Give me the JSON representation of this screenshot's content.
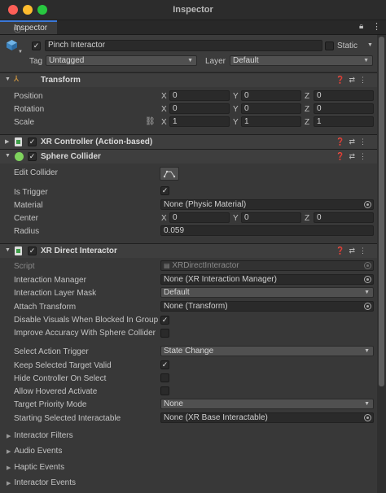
{
  "window": {
    "title": "Inspector"
  },
  "tab": {
    "label": "Inspector",
    "lock_icon": "lock-icon",
    "menu_icon": "kebab-icon"
  },
  "gameobject": {
    "name": "Pinch Interactor",
    "active": true,
    "static_label": "Static",
    "tag_label": "Tag",
    "tag_value": "Untagged",
    "layer_label": "Layer",
    "layer_value": "Default"
  },
  "transform": {
    "title": "Transform",
    "rows": [
      {
        "label": "Position",
        "x": "0",
        "y": "0",
        "z": "0"
      },
      {
        "label": "Rotation",
        "x": "0",
        "y": "0",
        "z": "0"
      },
      {
        "label": "Scale",
        "x": "1",
        "y": "1",
        "z": "1"
      }
    ]
  },
  "axis": {
    "x": "X",
    "y": "Y",
    "z": "Z"
  },
  "xr_controller": {
    "title": "XR Controller (Action-based)",
    "enabled": true
  },
  "sphere_collider": {
    "title": "Sphere Collider",
    "enabled": true,
    "edit_collider_label": "Edit Collider",
    "is_trigger_label": "Is Trigger",
    "is_trigger": true,
    "material_label": "Material",
    "material_value": "None (Physic Material)",
    "center_label": "Center",
    "center": {
      "x": "0",
      "y": "0",
      "z": "0"
    },
    "radius_label": "Radius",
    "radius_value": "0.059"
  },
  "xr_direct": {
    "title": "XR Direct Interactor",
    "enabled": true,
    "script_label": "Script",
    "script_value": "XRDirectInteractor",
    "interaction_manager_label": "Interaction Manager",
    "interaction_manager_value": "None (XR Interaction Manager)",
    "layer_mask_label": "Interaction Layer Mask",
    "layer_mask_value": "Default",
    "attach_transform_label": "Attach Transform",
    "attach_transform_value": "None (Transform)",
    "disable_visuals_label": "Disable Visuals When Blocked In Group",
    "disable_visuals": true,
    "improve_accuracy_label": "Improve Accuracy With Sphere Collider",
    "improve_accuracy": false,
    "select_trigger_label": "Select Action Trigger",
    "select_trigger_value": "State Change",
    "keep_selected_label": "Keep Selected Target Valid",
    "keep_selected": true,
    "hide_controller_label": "Hide Controller On Select",
    "hide_controller": false,
    "allow_hovered_label": "Allow Hovered Activate",
    "allow_hovered": false,
    "priority_mode_label": "Target Priority Mode",
    "priority_mode_value": "None",
    "starting_selected_label": "Starting Selected Interactable",
    "starting_selected_value": "None (XR Base Interactable)"
  },
  "sections": [
    {
      "label": "Interactor Filters"
    },
    {
      "label": "Audio Events"
    },
    {
      "label": "Haptic Events"
    },
    {
      "label": "Interactor Events"
    }
  ],
  "colors": {
    "accent": "#3b78d8",
    "close": "#fe5f57",
    "minimize": "#febc2e",
    "zoom": "#28c840"
  }
}
